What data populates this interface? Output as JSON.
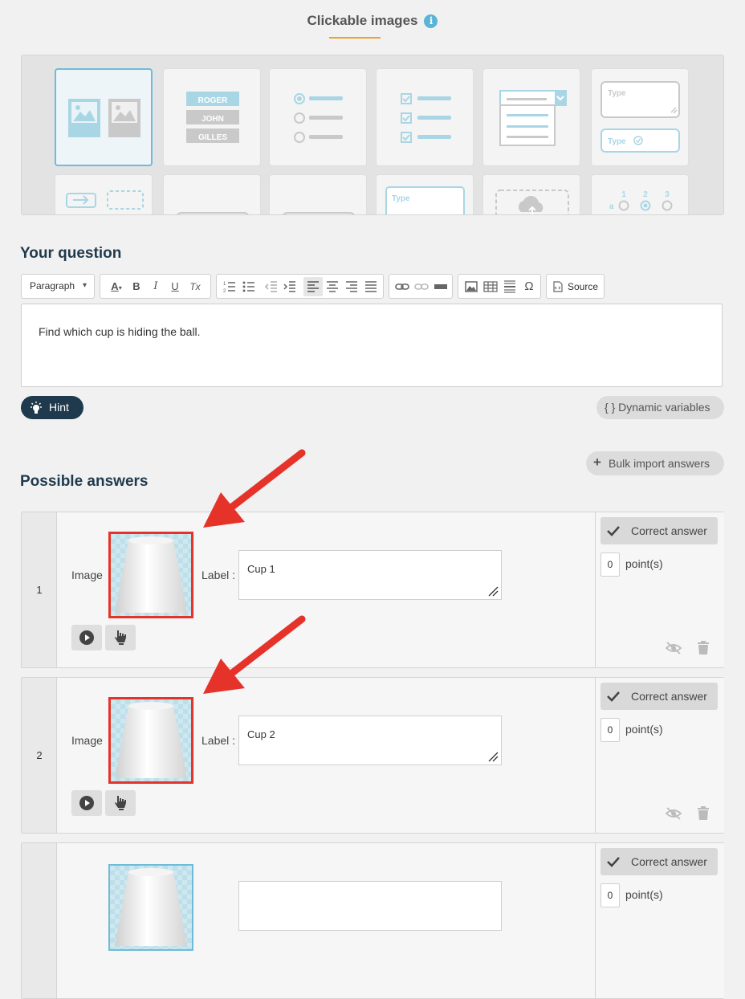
{
  "header": {
    "title": "Clickable images",
    "info_glyph": "i"
  },
  "picker": {
    "tiles": [
      {
        "name": "clickable-images"
      },
      {
        "name": "drag-labels",
        "words": [
          "ROGER",
          "JOHN",
          "GILLES"
        ]
      },
      {
        "name": "single-choice"
      },
      {
        "name": "multiple-choice"
      },
      {
        "name": "dropdown"
      },
      {
        "name": "free-text",
        "type_words": [
          "Type",
          "Type"
        ]
      },
      {
        "name": "drag-drop"
      },
      {
        "name": "blank-1"
      },
      {
        "name": "blank-2"
      },
      {
        "name": "fill-blank",
        "type_word": "Type"
      },
      {
        "name": "file-upload"
      },
      {
        "name": "matrix",
        "cols": [
          "1",
          "2",
          "3"
        ],
        "row": "a"
      }
    ]
  },
  "question": {
    "heading": "Your question",
    "toolbar": {
      "format_select": "Paragraph",
      "bold": "B",
      "italic": "I",
      "underline": "U",
      "clear": "Tx",
      "special_char": "Ω",
      "source_label": "Source"
    },
    "text": "Find which cup is hiding the ball.",
    "hint_label": "Hint",
    "dynamic_label": "{ } Dynamic variables"
  },
  "answers": {
    "heading": "Possible answers",
    "bulk_import_label": "Bulk import answers",
    "image_label": "Image",
    "label_label": "Label :",
    "correct_label": "Correct answer",
    "points_label": "point(s)",
    "items": [
      {
        "number": "1",
        "label_value": "Cup 1",
        "points": "0"
      },
      {
        "number": "2",
        "label_value": "Cup 2",
        "points": "0"
      },
      {
        "number": "",
        "label_value": "",
        "points": "0"
      }
    ]
  },
  "colors": {
    "accent": "#6fbcd8",
    "dark": "#1f3a4d",
    "highlight": "#e5332a",
    "underline": "#f0a030"
  }
}
